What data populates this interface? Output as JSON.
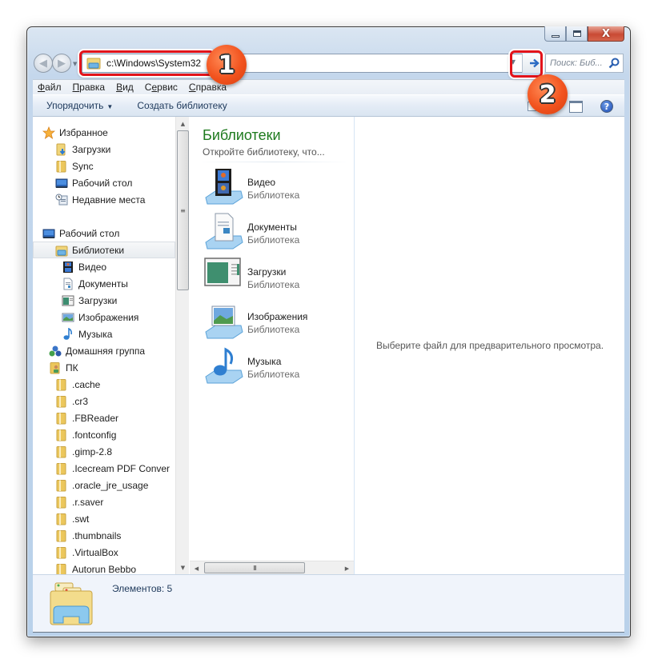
{
  "window": {
    "caption_buttons": {
      "minimize": "minimize",
      "maximize": "maximize",
      "close": "X"
    }
  },
  "address_bar": {
    "path": "c:\\Windows\\System32",
    "search_placeholder": "Поиск: Биб..."
  },
  "annotations": [
    {
      "number": "1",
      "target": "address-bar",
      "color": "#e3131a"
    },
    {
      "number": "2",
      "target": "go-button",
      "color": "#e3131a"
    }
  ],
  "menu": {
    "items": [
      {
        "label": "Файл",
        "accel": "Ф",
        "rest": "айл"
      },
      {
        "label": "Правка",
        "accel": "П",
        "rest": "равка"
      },
      {
        "label": "Вид",
        "accel": "В",
        "rest": "ид"
      },
      {
        "label": "Сервис",
        "accel_pre": "С",
        "accel": "е",
        "rest": "рвис"
      },
      {
        "label": "Справка",
        "accel": "С",
        "rest": "правка"
      }
    ]
  },
  "command_bar": {
    "organize": "Упорядочить",
    "create_library": "Создать библиотеку"
  },
  "nav_tree": {
    "items": [
      {
        "label": "Избранное",
        "icon": "star-icon",
        "level": 0
      },
      {
        "label": "Загрузки",
        "icon": "downloads-folder-icon",
        "level": 1
      },
      {
        "label": "Sync",
        "icon": "folder-icon",
        "level": 1
      },
      {
        "label": "Рабочий стол",
        "icon": "desktop-icon",
        "level": 1
      },
      {
        "label": "Недавние места",
        "icon": "recent-places-icon",
        "level": 1
      },
      {
        "label": "Рабочий стол",
        "icon": "desktop-icon",
        "level": 0
      },
      {
        "label": "Библиотеки",
        "icon": "libraries-icon",
        "level": 1,
        "selected": true
      },
      {
        "label": "Видео",
        "icon": "video-library-icon",
        "level": 2
      },
      {
        "label": "Документы",
        "icon": "documents-library-icon",
        "level": 2
      },
      {
        "label": "Загрузки",
        "icon": "downloads-library-icon",
        "level": 2
      },
      {
        "label": "Изображения",
        "icon": "pictures-library-icon",
        "level": 2
      },
      {
        "label": "Музыка",
        "icon": "music-library-icon",
        "level": 2
      },
      {
        "label": "Домашняя группа",
        "icon": "homegroup-icon",
        "level": 1
      },
      {
        "label": "ПК",
        "icon": "user-folder-icon",
        "level": 1
      },
      {
        "label": ".cache",
        "icon": "folder-icon",
        "level": 2
      },
      {
        "label": ".cr3",
        "icon": "folder-icon",
        "level": 2
      },
      {
        "label": ".FBReader",
        "icon": "folder-icon",
        "level": 2
      },
      {
        "label": ".fontconfig",
        "icon": "folder-icon",
        "level": 2
      },
      {
        "label": ".gimp-2.8",
        "icon": "folder-icon",
        "level": 2
      },
      {
        "label": ".Icecream PDF Conver",
        "icon": "folder-icon",
        "level": 2
      },
      {
        "label": ".oracle_jre_usage",
        "icon": "folder-icon",
        "level": 2
      },
      {
        "label": ".r.saver",
        "icon": "folder-icon",
        "level": 2
      },
      {
        "label": ".swt",
        "icon": "folder-icon",
        "level": 2
      },
      {
        "label": ".thumbnails",
        "icon": "folder-icon",
        "level": 2
      },
      {
        "label": ".VirtualBox",
        "icon": "folder-icon",
        "level": 2
      },
      {
        "label": "Autorun Bebbo",
        "icon": "folder-icon",
        "level": 2
      }
    ]
  },
  "libraries_pane": {
    "title": "Библиотеки",
    "subtitle": "Откройте библиотеку, что...",
    "items": [
      {
        "name": "Видео",
        "type": "Библиотека",
        "icon": "video-library-icon"
      },
      {
        "name": "Документы",
        "type": "Библиотека",
        "icon": "documents-library-icon"
      },
      {
        "name": "Загрузки",
        "type": "Библиотека",
        "icon": "downloads-library-icon"
      },
      {
        "name": "Изображения",
        "type": "Библиотека",
        "icon": "pictures-library-icon"
      },
      {
        "name": "Музыка",
        "type": "Библиотека",
        "icon": "music-library-icon"
      }
    ]
  },
  "preview_pane": {
    "message": "Выберите файл для предварительного просмотра."
  },
  "details_pane": {
    "items_count_text": "Элементов: 5"
  },
  "colors": {
    "annotation_red": "#e3131a",
    "badge_orange": "#f2531e",
    "library_title_green": "#1e7a1e"
  }
}
